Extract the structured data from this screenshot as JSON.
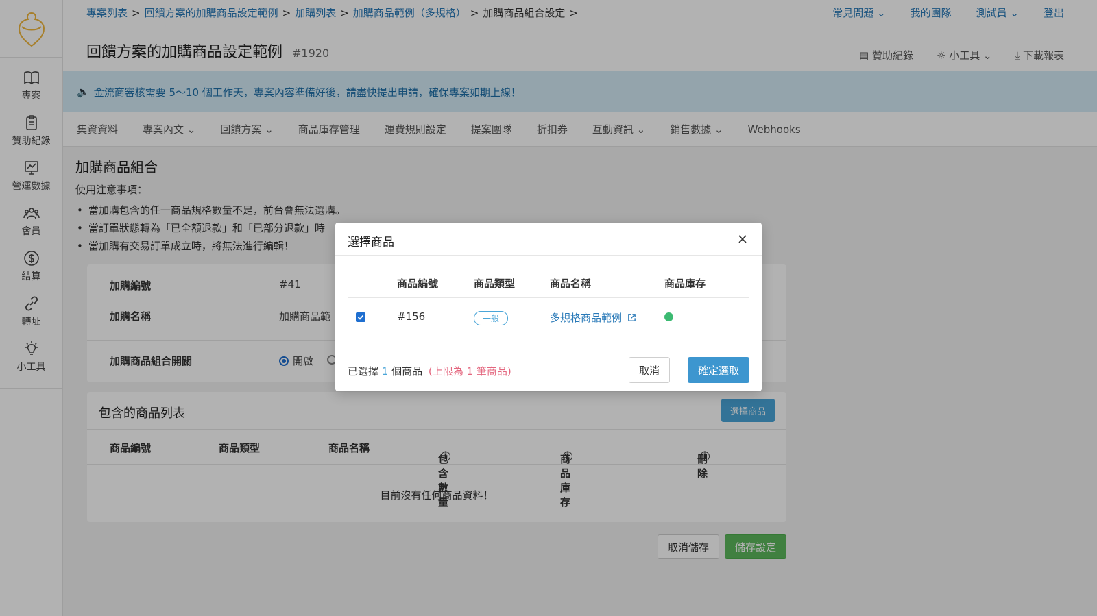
{
  "breadcrumb": {
    "items": [
      "專案列表",
      "回饋方案的加購商品設定範例",
      "加購列表",
      "加購商品範例（多規格）"
    ],
    "current": "加購商品組合設定",
    "sep": ">"
  },
  "top_links": {
    "faq": "常見問題",
    "team": "我的團隊",
    "user": "測試員",
    "logout": "登出"
  },
  "header": {
    "title": "回饋方案的加購商品設定範例",
    "project_id": "#1920"
  },
  "tools": {
    "sponsor": "贊助紀錄",
    "utilities": "小工具",
    "download": "下載報表"
  },
  "sidebar": {
    "items": [
      {
        "label": "專案"
      },
      {
        "label": "贊助紀錄"
      },
      {
        "label": "營運數據"
      },
      {
        "label": "會員"
      },
      {
        "label": "結算"
      },
      {
        "label": "轉址"
      },
      {
        "label": "小工具"
      }
    ]
  },
  "notice": "金流商審核需要 5～10 個工作天，專案內容準備好後，請盡快提出申請，確保專案如期上線！",
  "tabs": [
    "集資資料",
    "專案內文",
    "回饋方案",
    "商品庫存管理",
    "運費規則設定",
    "提案團隊",
    "折扣券",
    "互動資訊",
    "銷售數據",
    "Webhooks"
  ],
  "main": {
    "section_title": "加購商品組合",
    "notes_title": "使用注意事項：",
    "notes": [
      "當加購包含的任一商品規格數量不足，前台會無法選購。",
      "當訂單狀態轉為「已全額退款」和「已部分退款」時",
      "當加購有交易訂單成立時，將無法進行編輯！"
    ],
    "form": {
      "id_label": "加購編號",
      "id_value": "#41",
      "name_label": "加購名稱",
      "name_value": "加購商品範",
      "switch_label": "加購商品組合開關",
      "switch_on": "開啟"
    },
    "products": {
      "title": "包含的商品列表",
      "select_button": "選擇商品",
      "columns": [
        "商品編號",
        "商品類型",
        "商品名稱",
        "包含數量",
        "商品庫存",
        "刪除"
      ],
      "empty": "目前沒有任何商品資料！"
    },
    "cancel_save": "取消儲存",
    "save": "儲存設定"
  },
  "modal": {
    "title": "選擇商品",
    "columns": [
      "商品編號",
      "商品類型",
      "商品名稱",
      "商品庫存"
    ],
    "row": {
      "id": "#156",
      "type": "一般",
      "name": "多規格商品範例",
      "checked": true
    },
    "footer": {
      "prefix": "已選擇",
      "count": "1",
      "suffix": "個商品",
      "limit": "(上限為 1 筆商品)"
    },
    "cancel": "取消",
    "confirm": "確定選取"
  },
  "colors": {
    "accent": "#2a7ab8",
    "primary_button": "#3d96cf",
    "save_green": "#5cb85c",
    "stock_dot": "#3cba72",
    "limit_red": "#e4677f"
  }
}
